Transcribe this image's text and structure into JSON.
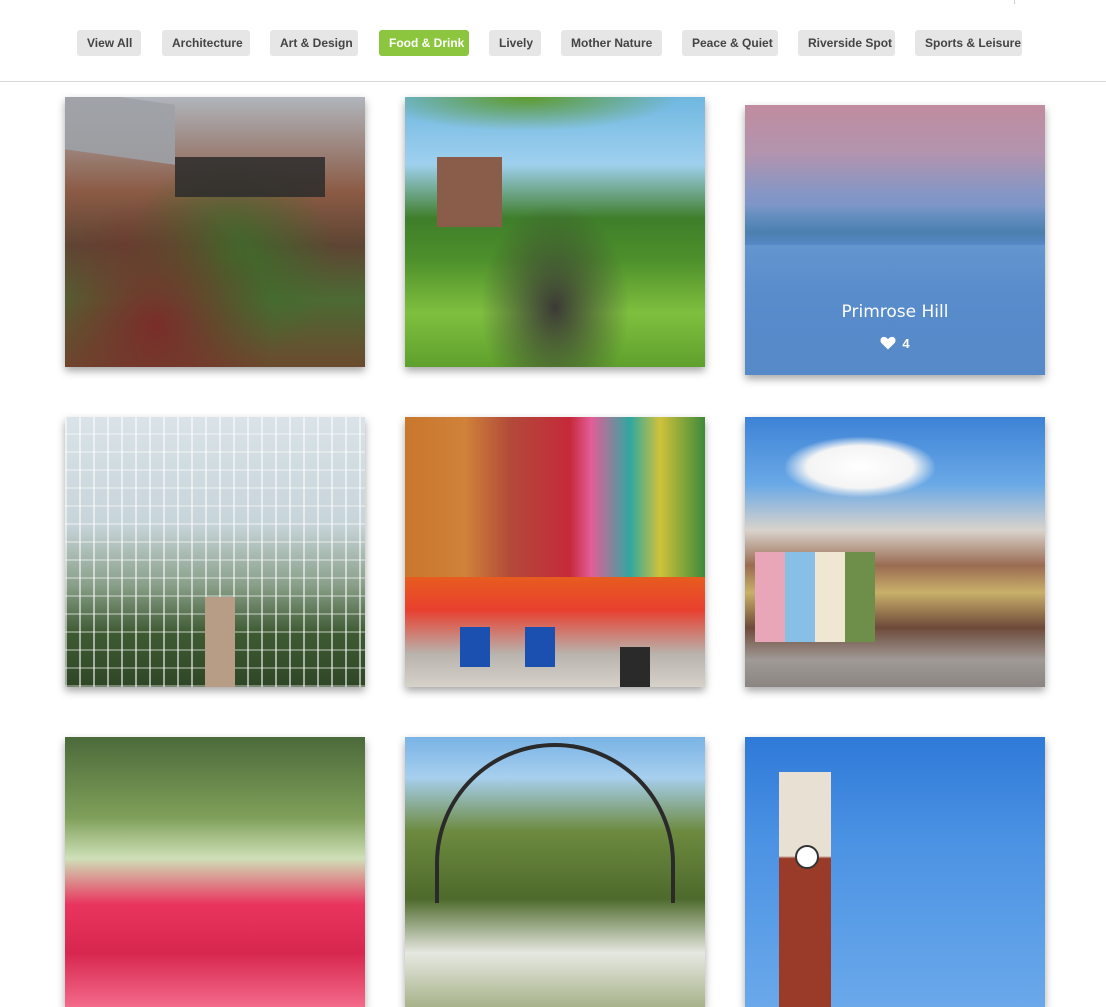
{
  "filters": [
    {
      "label": "View All",
      "active": false
    },
    {
      "label": "Architecture",
      "active": false
    },
    {
      "label": "Art & Design",
      "active": false
    },
    {
      "label": "Food & Drink",
      "active": true
    },
    {
      "label": "Lively",
      "active": false
    },
    {
      "label": "Mother Nature",
      "active": false
    },
    {
      "label": "Peace & Quiet",
      "active": false
    },
    {
      "label": "Riverside Spot",
      "active": false
    },
    {
      "label": "Sports & Leisure",
      "active": false
    }
  ],
  "accent_color": "#8cc63f",
  "cards": [
    {
      "photo": "garden-market-photo"
    },
    {
      "photo": "park-picnic-photo"
    },
    {
      "photo": "primrose-hill-photo",
      "title": "Primrose Hill",
      "likes": "4",
      "hovered": true
    },
    {
      "photo": "glasshouse-photo"
    },
    {
      "photo": "colourful-street-photo"
    },
    {
      "photo": "notting-hill-street-photo"
    },
    {
      "photo": "flower-woodland-photo"
    },
    {
      "photo": "garden-arch-photo"
    },
    {
      "photo": "clock-tower-photo"
    }
  ],
  "icons": {
    "likes": "heart-icon"
  }
}
